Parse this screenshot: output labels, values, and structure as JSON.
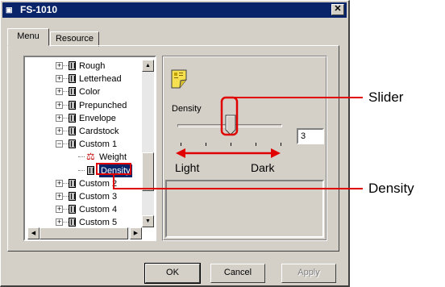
{
  "window": {
    "title": "FS-1010",
    "title_icon": "printer-icon",
    "close_label": "✕"
  },
  "tabs": [
    {
      "label": "Menu",
      "active": true
    },
    {
      "label": "Resource",
      "active": false
    }
  ],
  "tree": {
    "items": [
      {
        "label": "Rough",
        "expander": "+",
        "icon": "folder-icon"
      },
      {
        "label": "Letterhead",
        "expander": "+",
        "icon": "folder-icon"
      },
      {
        "label": "Color",
        "expander": "+",
        "icon": "folder-icon"
      },
      {
        "label": "Prepunched",
        "expander": "+",
        "icon": "folder-icon"
      },
      {
        "label": "Envelope",
        "expander": "+",
        "icon": "folder-icon"
      },
      {
        "label": "Cardstock",
        "expander": "+",
        "icon": "folder-icon"
      },
      {
        "label": "Custom 1",
        "expander": "−",
        "icon": "folder-icon"
      },
      {
        "label": "Weight",
        "icon": "weight-icon",
        "child": true
      },
      {
        "label": "Density",
        "icon": "density-icon",
        "child": true,
        "selected": true
      },
      {
        "label": "Custom 2",
        "expander": "+",
        "icon": "folder-icon"
      },
      {
        "label": "Custom 3",
        "expander": "+",
        "icon": "folder-icon"
      },
      {
        "label": "Custom 4",
        "expander": "+",
        "icon": "folder-icon"
      },
      {
        "label": "Custom 5",
        "expander": "+",
        "icon": "folder-icon"
      }
    ]
  },
  "settings": {
    "icon": "paper-icon",
    "density_label": "Density",
    "slider_value": "3",
    "light_label": "Light",
    "dark_label": "Dark"
  },
  "buttons": {
    "ok": "OK",
    "cancel": "Cancel",
    "apply": "Apply"
  },
  "callouts": {
    "slider": "Slider",
    "density": "Density"
  },
  "colors": {
    "title_bar": "#0a246a",
    "dialog_face": "#d4d0c8",
    "selection": "#0a246a",
    "callout": "#e00000"
  }
}
